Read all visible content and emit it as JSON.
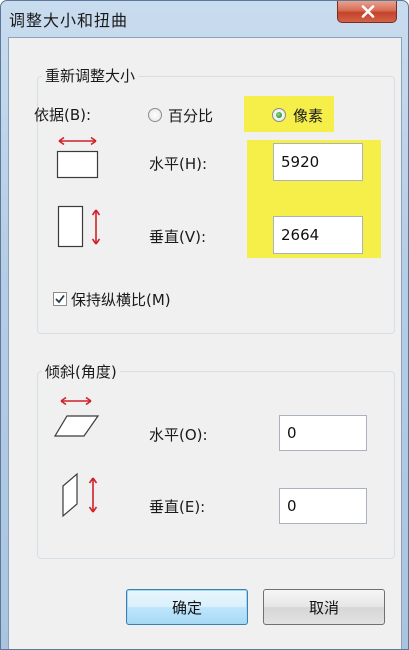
{
  "window": {
    "title": "调整大小和扭曲"
  },
  "resize": {
    "group_label": "重新调整大小",
    "by_label": "依据(B):",
    "option_percent": "百分比",
    "option_pixels": "像素",
    "selected_option": "像素",
    "horizontal_label": "水平(H):",
    "horizontal_value": "5920",
    "vertical_label": "垂直(V):",
    "vertical_value": "2664",
    "keep_ratio_label": "保持纵横比(M)",
    "keep_ratio_checked": true
  },
  "skew": {
    "group_label": "倾斜(角度)",
    "horizontal_label": "水平(O):",
    "horizontal_value": "0",
    "vertical_label": "垂直(E):",
    "vertical_value": "0"
  },
  "buttons": {
    "ok_label": "确定",
    "cancel_label": "取消"
  },
  "colors": {
    "highlight": "#f6ef4a",
    "arrow_red": "#d0202a",
    "title_bar": "#b6cde6"
  },
  "icons": {
    "close": "close-icon",
    "resize_horizontal": "resize-horizontal-icon",
    "resize_vertical": "resize-vertical-icon",
    "skew_horizontal": "skew-horizontal-icon",
    "skew_vertical": "skew-vertical-icon"
  }
}
